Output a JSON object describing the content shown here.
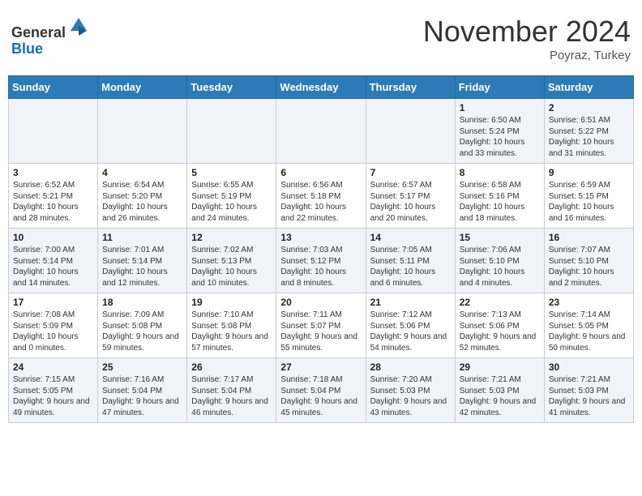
{
  "header": {
    "logo_line1": "General",
    "logo_line2": "Blue",
    "month_title": "November 2024",
    "location": "Poyraz, Turkey"
  },
  "weekdays": [
    "Sunday",
    "Monday",
    "Tuesday",
    "Wednesday",
    "Thursday",
    "Friday",
    "Saturday"
  ],
  "weeks": [
    [
      {
        "day": "",
        "info": ""
      },
      {
        "day": "",
        "info": ""
      },
      {
        "day": "",
        "info": ""
      },
      {
        "day": "",
        "info": ""
      },
      {
        "day": "",
        "info": ""
      },
      {
        "day": "1",
        "info": "Sunrise: 6:50 AM\nSunset: 5:24 PM\nDaylight: 10 hours and 33 minutes."
      },
      {
        "day": "2",
        "info": "Sunrise: 6:51 AM\nSunset: 5:22 PM\nDaylight: 10 hours and 31 minutes."
      }
    ],
    [
      {
        "day": "3",
        "info": "Sunrise: 6:52 AM\nSunset: 5:21 PM\nDaylight: 10 hours and 28 minutes."
      },
      {
        "day": "4",
        "info": "Sunrise: 6:54 AM\nSunset: 5:20 PM\nDaylight: 10 hours and 26 minutes."
      },
      {
        "day": "5",
        "info": "Sunrise: 6:55 AM\nSunset: 5:19 PM\nDaylight: 10 hours and 24 minutes."
      },
      {
        "day": "6",
        "info": "Sunrise: 6:56 AM\nSunset: 5:18 PM\nDaylight: 10 hours and 22 minutes."
      },
      {
        "day": "7",
        "info": "Sunrise: 6:57 AM\nSunset: 5:17 PM\nDaylight: 10 hours and 20 minutes."
      },
      {
        "day": "8",
        "info": "Sunrise: 6:58 AM\nSunset: 5:16 PM\nDaylight: 10 hours and 18 minutes."
      },
      {
        "day": "9",
        "info": "Sunrise: 6:59 AM\nSunset: 5:15 PM\nDaylight: 10 hours and 16 minutes."
      }
    ],
    [
      {
        "day": "10",
        "info": "Sunrise: 7:00 AM\nSunset: 5:14 PM\nDaylight: 10 hours and 14 minutes."
      },
      {
        "day": "11",
        "info": "Sunrise: 7:01 AM\nSunset: 5:14 PM\nDaylight: 10 hours and 12 minutes."
      },
      {
        "day": "12",
        "info": "Sunrise: 7:02 AM\nSunset: 5:13 PM\nDaylight: 10 hours and 10 minutes."
      },
      {
        "day": "13",
        "info": "Sunrise: 7:03 AM\nSunset: 5:12 PM\nDaylight: 10 hours and 8 minutes."
      },
      {
        "day": "14",
        "info": "Sunrise: 7:05 AM\nSunset: 5:11 PM\nDaylight: 10 hours and 6 minutes."
      },
      {
        "day": "15",
        "info": "Sunrise: 7:06 AM\nSunset: 5:10 PM\nDaylight: 10 hours and 4 minutes."
      },
      {
        "day": "16",
        "info": "Sunrise: 7:07 AM\nSunset: 5:10 PM\nDaylight: 10 hours and 2 minutes."
      }
    ],
    [
      {
        "day": "17",
        "info": "Sunrise: 7:08 AM\nSunset: 5:09 PM\nDaylight: 10 hours and 0 minutes."
      },
      {
        "day": "18",
        "info": "Sunrise: 7:09 AM\nSunset: 5:08 PM\nDaylight: 9 hours and 59 minutes."
      },
      {
        "day": "19",
        "info": "Sunrise: 7:10 AM\nSunset: 5:08 PM\nDaylight: 9 hours and 57 minutes."
      },
      {
        "day": "20",
        "info": "Sunrise: 7:11 AM\nSunset: 5:07 PM\nDaylight: 9 hours and 55 minutes."
      },
      {
        "day": "21",
        "info": "Sunrise: 7:12 AM\nSunset: 5:06 PM\nDaylight: 9 hours and 54 minutes."
      },
      {
        "day": "22",
        "info": "Sunrise: 7:13 AM\nSunset: 5:06 PM\nDaylight: 9 hours and 52 minutes."
      },
      {
        "day": "23",
        "info": "Sunrise: 7:14 AM\nSunset: 5:05 PM\nDaylight: 9 hours and 50 minutes."
      }
    ],
    [
      {
        "day": "24",
        "info": "Sunrise: 7:15 AM\nSunset: 5:05 PM\nDaylight: 9 hours and 49 minutes."
      },
      {
        "day": "25",
        "info": "Sunrise: 7:16 AM\nSunset: 5:04 PM\nDaylight: 9 hours and 47 minutes."
      },
      {
        "day": "26",
        "info": "Sunrise: 7:17 AM\nSunset: 5:04 PM\nDaylight: 9 hours and 46 minutes."
      },
      {
        "day": "27",
        "info": "Sunrise: 7:18 AM\nSunset: 5:04 PM\nDaylight: 9 hours and 45 minutes."
      },
      {
        "day": "28",
        "info": "Sunrise: 7:20 AM\nSunset: 5:03 PM\nDaylight: 9 hours and 43 minutes."
      },
      {
        "day": "29",
        "info": "Sunrise: 7:21 AM\nSunset: 5:03 PM\nDaylight: 9 hours and 42 minutes."
      },
      {
        "day": "30",
        "info": "Sunrise: 7:21 AM\nSunset: 5:03 PM\nDaylight: 9 hours and 41 minutes."
      }
    ]
  ]
}
